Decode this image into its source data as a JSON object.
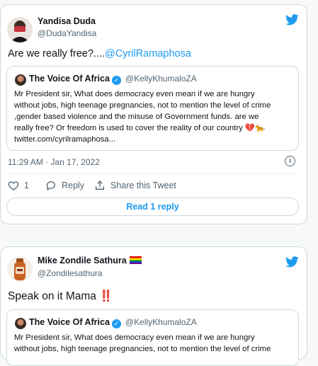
{
  "tweet1": {
    "author_name": "Yandisa Duda",
    "author_handle": "@DudaYandisa",
    "text_prefix": "Are we really free?....",
    "text_mention": "@CyrilRamaphosa",
    "quote": {
      "author_name": "The Voice Of Africa",
      "author_handle": "@KellyKhumaloZA",
      "lines": [
        "Mr President sir, What does democracy even mean if we are hungry",
        "without jobs, high teenage pregnancies, not to mention the level of crime",
        ",gender based violence and the misuse of Government funds. are we",
        "really free? Or freedom is used to cover the reality of our country",
        "twitter.com/cyrilramaphosa..."
      ],
      "emoji_heart": "💔",
      "emoji_leopard": "🐆"
    },
    "timestamp": "11:29 AM · Jan 17, 2022",
    "like_count": "1",
    "reply_label": "Reply",
    "share_label": "Share this Tweet",
    "read_replies_label": "Read 1 reply"
  },
  "tweet2": {
    "author_name": "Mike Zondile Sathura",
    "author_handle": "@Zondilesathura",
    "text": "Speak on it Mama",
    "text_emoji": "‼️",
    "quote": {
      "author_name": "The Voice Of Africa",
      "author_handle": "@KellyKhumaloZA",
      "lines": [
        "Mr President sir, What does democracy even mean if we are hungry",
        "without jobs, high teenage pregnancies, not to mention the level of crime"
      ]
    }
  },
  "colors": {
    "accent": "#1d9bf0",
    "text": "#0f1419",
    "muted": "#536471",
    "border": "#cfd9de",
    "background": "#f7f9f9"
  },
  "icons": [
    "twitter-bird-icon",
    "verified-badge-icon",
    "info-icon",
    "heart-icon",
    "reply-icon",
    "share-icon",
    "rainbow-flag-icon"
  ]
}
